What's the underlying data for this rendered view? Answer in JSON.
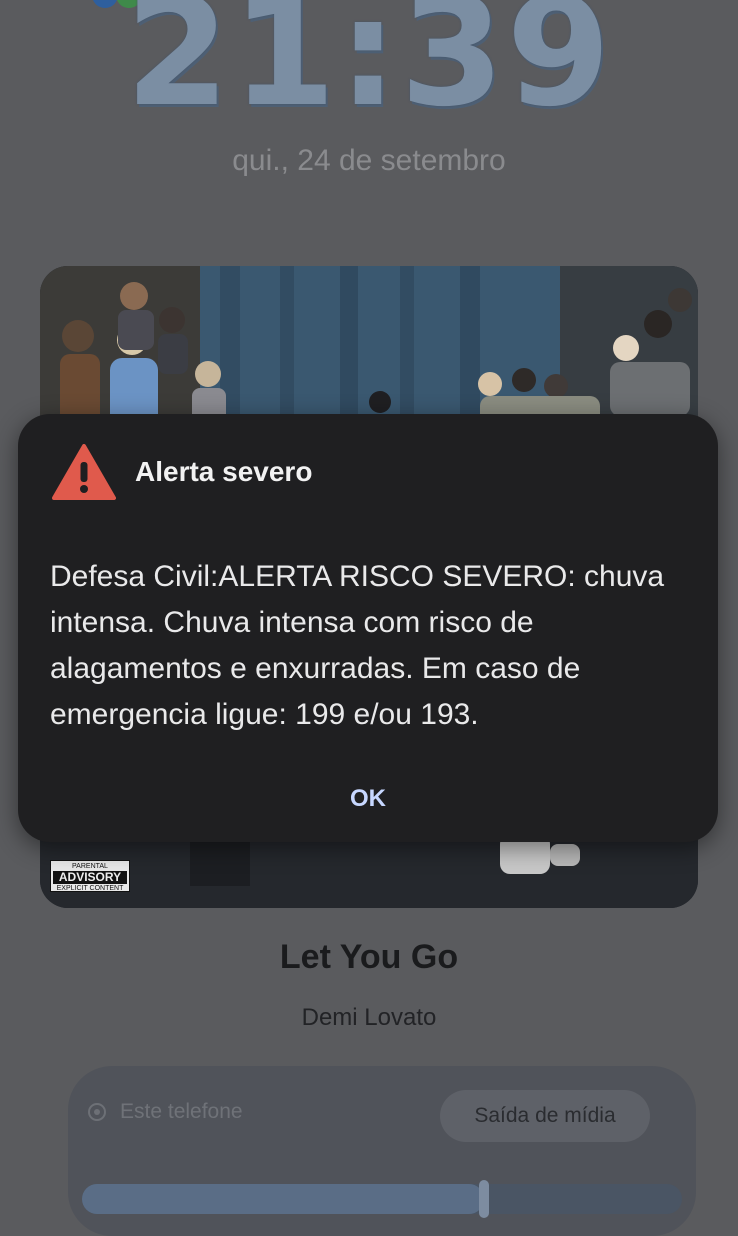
{
  "lock_screen": {
    "time": "21:39",
    "date": "qui., 24 de setembro"
  },
  "media": {
    "parental_advisory_top": "PARENTAL",
    "parental_advisory_main": "ADVISORY",
    "parental_advisory_bottom": "EXPLICIT CONTENT",
    "song_title": "Let You Go",
    "artist": "Demi Lovato",
    "output_device_label": "Este telefone",
    "output_button_label": "Saída de mídia",
    "volume_level": 0.67
  },
  "alert": {
    "icon": "warning-triangle-icon",
    "title": "Alerta severo",
    "body": "Defesa Civil:ALERTA RISCO SEVERO: chuva intensa. Chuva intensa com risco de alagamentos e enxurradas. Em caso de emergencia ligue: 199 e/ou 193.",
    "ok_label": "OK"
  },
  "colors": {
    "alert_icon": "#e05a4c",
    "dialog_background": "#1f1f21",
    "ok_text": "#c7d7ff"
  }
}
